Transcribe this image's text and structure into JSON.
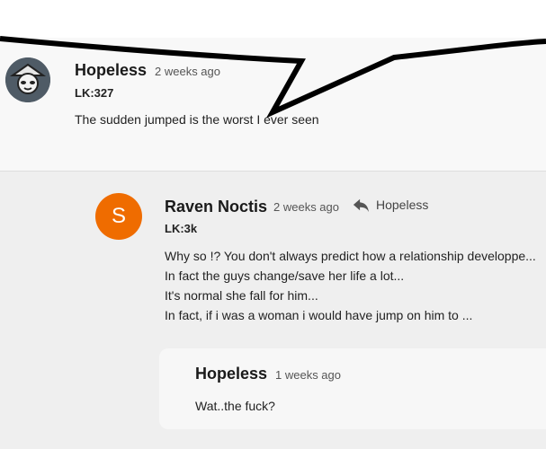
{
  "comment": {
    "username": "Hopeless",
    "time": "2 weeks ago",
    "lk": "LK:327",
    "text": "The sudden jumped is the worst I ever seen"
  },
  "reply": {
    "avatar_letter": "S",
    "avatar_color": "#ef6c00",
    "username": "Raven Noctis",
    "time": "2 weeks ago",
    "reply_to": "Hopeless",
    "lk": "LK:3k",
    "lines": [
      "Why so !? You don't always predict how a relationship developpe...",
      "In fact the guys change/save her life a lot...",
      "It's normal she fall for him...",
      "In fact, if i was a woman i would have jump on him to ..."
    ]
  },
  "nested_reply": {
    "username": "Hopeless",
    "time": "1 weeks ago",
    "text": "Wat..the fuck?"
  },
  "icons": {
    "reply_arrow": "reply-arrow-icon",
    "avatar_main": "panda-avatar-icon"
  }
}
